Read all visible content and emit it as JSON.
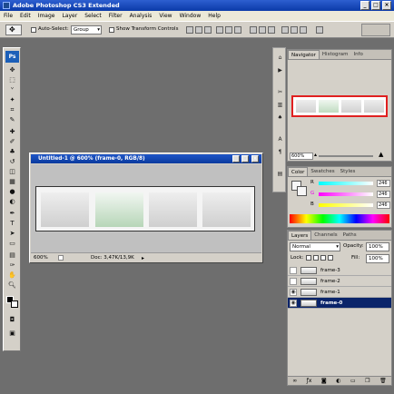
{
  "app": {
    "title": "Adobe Photoshop CS3 Extended"
  },
  "window_controls": {
    "minimize": "_",
    "maximize": "□",
    "close": "×"
  },
  "menu": [
    "File",
    "Edit",
    "Image",
    "Layer",
    "Select",
    "Filter",
    "Analysis",
    "View",
    "Window",
    "Help"
  ],
  "options_bar": {
    "auto_select_label": "Auto-Select:",
    "auto_select_value": "Group",
    "transform_label": "Show Transform Controls"
  },
  "toolbox": {
    "logo": "Ps"
  },
  "document": {
    "title": "Untitled-1 @ 600% (frame-0, RGB/8)",
    "zoom": "600%",
    "status": "Doc: 3,47K/13,9K"
  },
  "navigator": {
    "tabs": [
      "Navigator",
      "Histogram",
      "Info"
    ],
    "zoom": "600%"
  },
  "color": {
    "tabs": [
      "Color",
      "Swatches",
      "Styles"
    ],
    "channels": [
      {
        "label": "R",
        "value": "246",
        "color": "#e84f9a"
      },
      {
        "label": "G",
        "value": "246",
        "color": "#ff33ff"
      },
      {
        "label": "B",
        "value": "246",
        "color": "#e8e84f"
      }
    ]
  },
  "layers": {
    "tabs": [
      "Layers",
      "Channels",
      "Paths"
    ],
    "blend_mode": "Normal",
    "opacity_label": "Opacity:",
    "opacity_value": "100%",
    "lock_label": "Lock:",
    "fill_label": "Fill:",
    "fill_value": "100%",
    "items": [
      {
        "name": "frame-3",
        "visible": false,
        "selected": false
      },
      {
        "name": "frame-2",
        "visible": false,
        "selected": false
      },
      {
        "name": "frame-1",
        "visible": true,
        "selected": false
      },
      {
        "name": "frame-0",
        "visible": true,
        "selected": true
      }
    ]
  },
  "icons": {
    "eye": "eye-icon",
    "link": "link-icon",
    "fx": "fx-icon",
    "mask": "mask-icon",
    "adjustment": "adjustment-icon",
    "folder": "folder-icon",
    "new_layer": "new-layer-icon",
    "trash": "trash-icon"
  }
}
